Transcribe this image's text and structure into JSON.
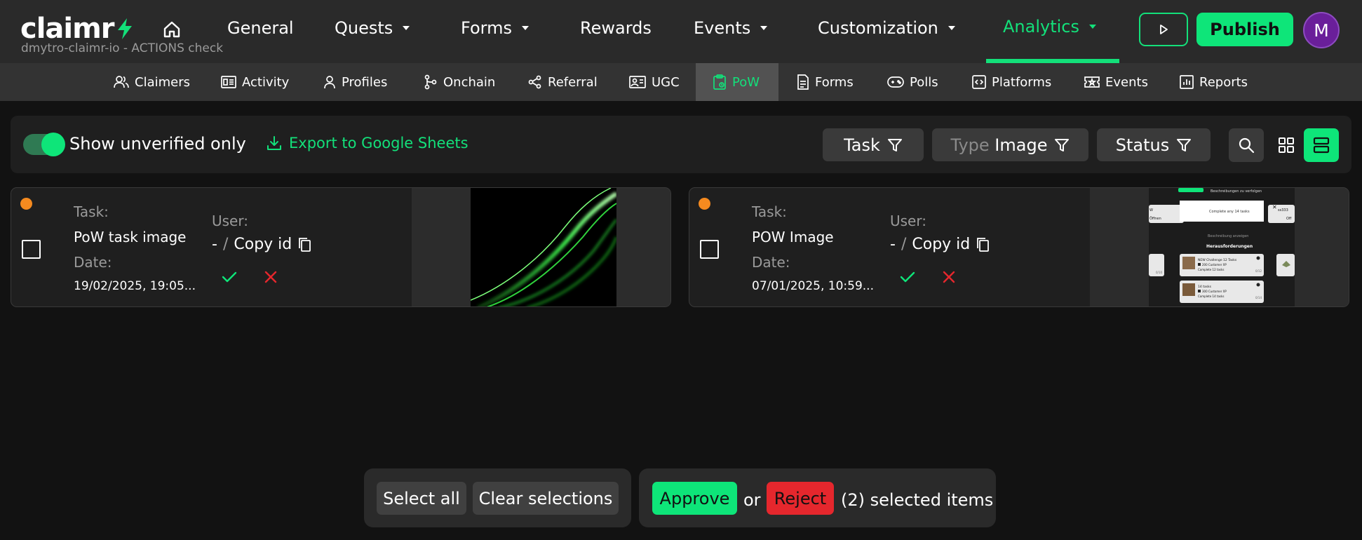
{
  "app": {
    "logo_text": "claimr",
    "workspace": "dmytro-claimr-io - ACTIONS check"
  },
  "nav": {
    "items": [
      {
        "label": "General"
      },
      {
        "label": "Quests"
      },
      {
        "label": "Forms"
      },
      {
        "label": "Rewards"
      },
      {
        "label": "Events"
      },
      {
        "label": "Customization"
      },
      {
        "label": "Analytics"
      }
    ],
    "active": "Analytics",
    "publish_label": "Publish",
    "avatar_initial": "M"
  },
  "subnav": {
    "items": [
      {
        "label": "Claimers",
        "icon": "users-icon"
      },
      {
        "label": "Activity",
        "icon": "activity-card-icon"
      },
      {
        "label": "Profiles",
        "icon": "person-icon"
      },
      {
        "label": "Onchain",
        "icon": "nodes-icon"
      },
      {
        "label": "Referral",
        "icon": "share-icon"
      },
      {
        "label": "UGC",
        "icon": "image-card-icon"
      },
      {
        "label": "PoW",
        "icon": "clipboard-icon"
      },
      {
        "label": "Forms",
        "icon": "document-icon"
      },
      {
        "label": "Polls",
        "icon": "gamepad-icon"
      },
      {
        "label": "Platforms",
        "icon": "code-icon"
      },
      {
        "label": "Events",
        "icon": "ticket-icon"
      },
      {
        "label": "Reports",
        "icon": "bar-chart-icon"
      }
    ],
    "active": "PoW"
  },
  "toolbar": {
    "toggle_label": "Show unverified only",
    "toggle_on": true,
    "export_label": "Export to Google Sheets",
    "filter_task": "Task",
    "filter_type_prefix": "Type",
    "filter_type_value": "Image",
    "filter_status": "Status"
  },
  "submissions": {
    "task_label": "Task:",
    "date_label": "Date:",
    "user_label": "User:",
    "user_dash": "-",
    "user_sep": "/",
    "copy_label": "Copy id",
    "items": [
      {
        "task": "PoW task image",
        "date": "19/02/2025, 19:05..."
      },
      {
        "task": "POW Image",
        "date": "07/01/2025, 10:59..."
      }
    ]
  },
  "screenshot_thumb": {
    "top": "Beschreibungen zu verfolgen",
    "modal": "Complete any 14 tasks",
    "left": "W",
    "left2": "Öffnen",
    "right": "ss333",
    "right2": "Off",
    "link": "Beschreibung anzeigen",
    "heading": "Herausforderungen",
    "card1_title": "NEW Challenge 12 Tasks",
    "card1_xp": "200 Customer XP",
    "card1_progress": "Complete 12 tasks",
    "card1_count": "0/12",
    "card2_title": "14 tasks",
    "card2_xp": "300 Customer XP",
    "card2_progress": "Complete 14 tasks",
    "card2_count": "0/14",
    "side_count": "0/10"
  },
  "bulk": {
    "select_all": "Select all",
    "clear_selections": "Clear selections",
    "approve": "Approve",
    "or": "or",
    "reject": "Reject",
    "selected_text": "(2) selected items"
  },
  "colors": {
    "accent": "#0ee579",
    "reject": "#e5272d",
    "pending_dot": "#f58a1f"
  }
}
